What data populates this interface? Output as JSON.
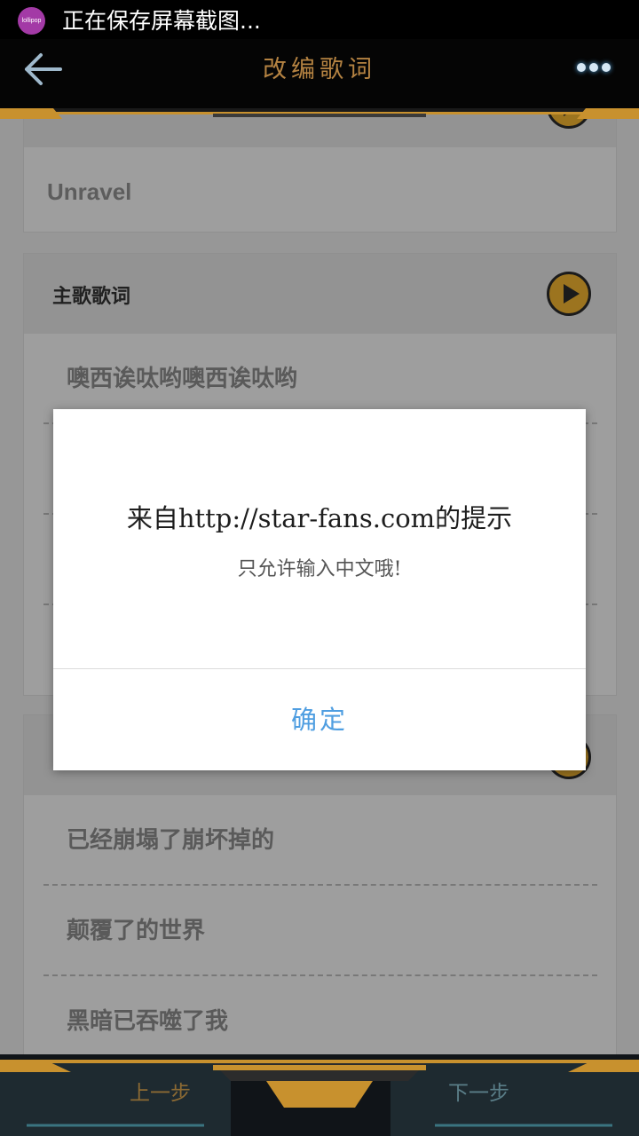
{
  "status_bar": {
    "logo": "lollipop",
    "text": "正在保存屏幕截图..."
  },
  "header": {
    "title": "改编歌词",
    "back_icon": "arrow-left-icon",
    "more_icon": "more-dots-icon"
  },
  "song_card": {
    "title": "Unravel"
  },
  "verse_card": {
    "label": "主歌歌词",
    "lines": [
      "噢西诶呔哟噢西诶呔哟"
    ]
  },
  "chorus_card": {
    "lines": [
      "已经崩塌了崩坏掉的",
      "颠覆了的世界",
      "黑暗已吞噬了我"
    ]
  },
  "bottom_nav": {
    "prev_label": "上一步",
    "next_label": "下一步"
  },
  "dialog": {
    "title": "来自http://star-fans.com的提示",
    "message": "只允许输入中文哦!",
    "ok_label": "确定"
  },
  "colors": {
    "accent_gold": "#b58342",
    "play_yellow": "#f0b330",
    "dialog_button": "#4f9ee1"
  }
}
